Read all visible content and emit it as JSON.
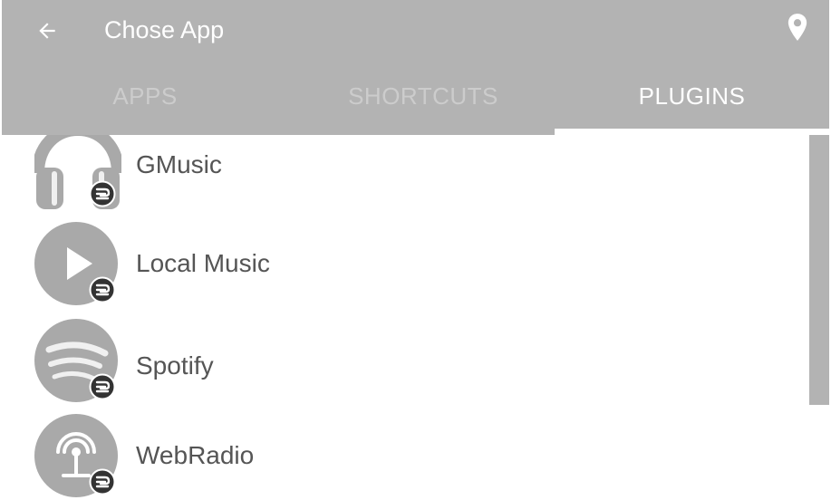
{
  "app_bar": {
    "title": "Chose App",
    "back_icon": "arrow-left-icon",
    "location_icon": "map-pin-icon",
    "background": "#b3b3b3"
  },
  "tabs": [
    {
      "label": "APPS",
      "active": false
    },
    {
      "label": "SHORTCUTS",
      "active": false
    },
    {
      "label": "PLUGINS",
      "active": true
    }
  ],
  "plugins": [
    {
      "label": "GMusic",
      "icon": "headphones-icon"
    },
    {
      "label": "Local Music",
      "icon": "play-icon"
    },
    {
      "label": "Spotify",
      "icon": "spotify-icon"
    },
    {
      "label": "WebRadio",
      "icon": "radio-antenna-icon"
    }
  ],
  "colors": {
    "icon_grey": "#a9a9a9",
    "badge": "#333333",
    "text": "#555555",
    "tab_inactive": "#cccccc"
  }
}
